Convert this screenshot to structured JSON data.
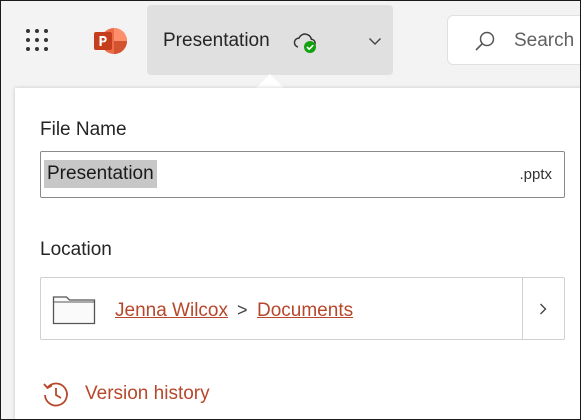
{
  "app": {
    "icon_name": "powerpoint-logo-icon",
    "accent_color": "#b7472a"
  },
  "header": {
    "app_launcher_icon": "waffle-grid-icon",
    "document_title": "Presentation",
    "sync_status_icon": "cloud-saved-icon",
    "dropdown_icon": "chevron-down-icon",
    "search": {
      "placeholder": "Search",
      "icon": "search-icon"
    }
  },
  "file_panel": {
    "file_name_label": "File Name",
    "file_name_value": "Presentation",
    "file_extension": ".pptx",
    "location_label": "Location",
    "location_path": [
      {
        "label": "Jenna Wilcox"
      },
      {
        "label": "Documents"
      }
    ],
    "location_folder_icon": "folder-icon",
    "location_separator": ">",
    "location_browse_icon": "chevron-right-icon",
    "version_history_label": "Version history",
    "version_history_icon": "history-icon"
  }
}
